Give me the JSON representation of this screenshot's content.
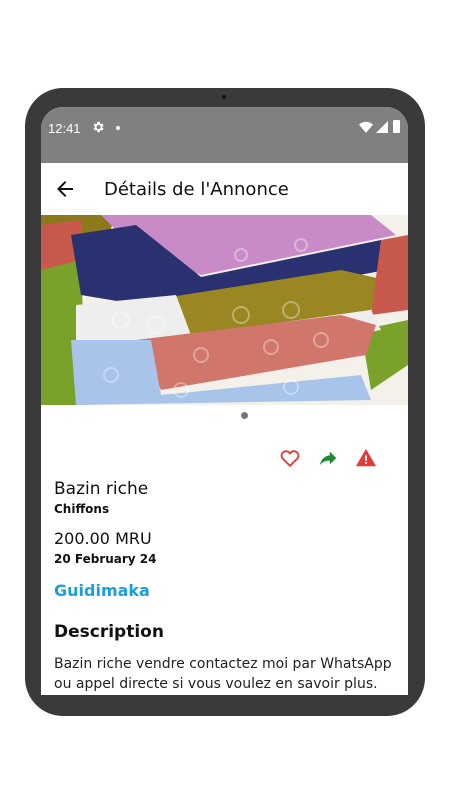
{
  "status": {
    "time": "12:41"
  },
  "appbar": {
    "title": "Détails de l'Annonce"
  },
  "listing": {
    "title": "Bazin riche",
    "category": "Chiffons",
    "price": "200.00 MRU",
    "date": "20 February 24",
    "location": "Guidimaka",
    "description_heading": "Description",
    "description": "Bazin riche  vendre contactez moi par WhatsApp ou appel directe si vous voulez en savoir plus."
  },
  "colors": {
    "location": "#1a9fdc",
    "favorite": "#e53935",
    "share": "#1b8a2f",
    "report": "#e53935",
    "statusbar": "#808080"
  },
  "icons": [
    "settings-icon",
    "wifi-icon",
    "signal-icon",
    "battery-icon",
    "back-arrow-icon",
    "heart-icon",
    "share-icon",
    "warning-icon"
  ]
}
